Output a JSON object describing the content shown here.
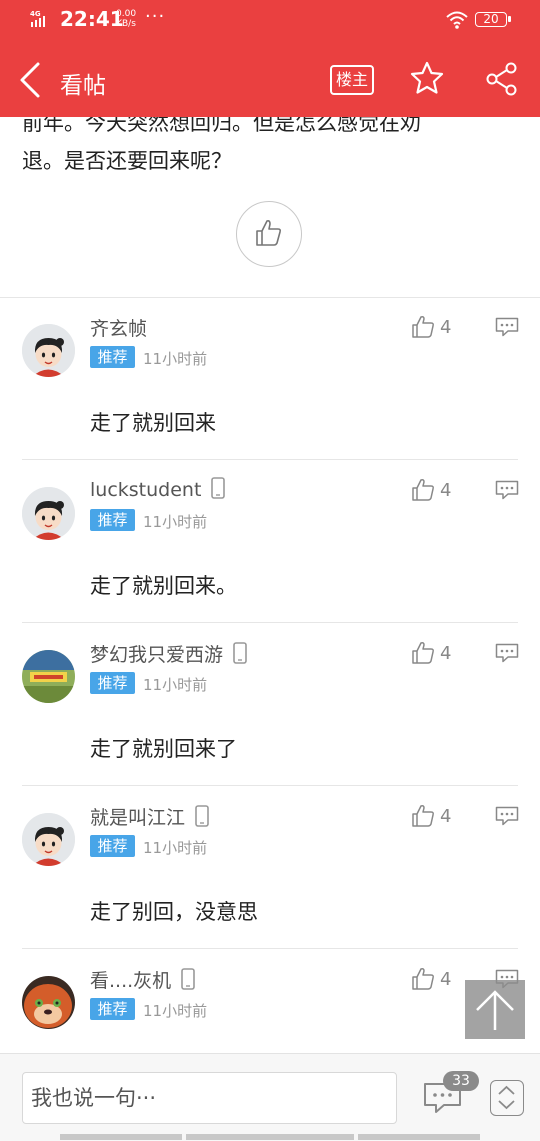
{
  "status": {
    "network": "4G HD",
    "time": "22:41",
    "speed_value": "0.00",
    "speed_unit": "KB/s",
    "dots": "···",
    "battery": "20"
  },
  "appbar": {
    "title": "看帖",
    "host_label": "楼主",
    "back_icon": "chevron-left-icon",
    "star_icon": "star-icon",
    "share_icon": "share-icon"
  },
  "post": {
    "line1": "前年。今天突然想回归。但是怎么感觉在劝",
    "line2": "退。是否还要回来呢？"
  },
  "comments": [
    {
      "user": "齐玄帧",
      "phone": false,
      "badge": "推荐",
      "time": "11小时前",
      "likes": "4",
      "text": "走了就别回来"
    },
    {
      "user": "luckstudent",
      "phone": true,
      "badge": "推荐",
      "time": "11小时前",
      "likes": "4",
      "text": "走了就别回来。"
    },
    {
      "user": "梦幻我只爱西游",
      "phone": true,
      "badge": "推荐",
      "time": "11小时前",
      "likes": "4",
      "text": "走了就别回来了"
    },
    {
      "user": "就是叫江江",
      "phone": true,
      "badge": "推荐",
      "time": "11小时前",
      "likes": "4",
      "text": "走了别回，没意思"
    },
    {
      "user": "看....灰机",
      "phone": true,
      "badge": "推荐",
      "time": "11小时前",
      "likes": "4",
      "text": ""
    }
  ],
  "bottom": {
    "placeholder": "我也说一句···",
    "comment_count": "33"
  },
  "colors": {
    "brand": "#ea4040",
    "badge": "#48a5e8"
  }
}
